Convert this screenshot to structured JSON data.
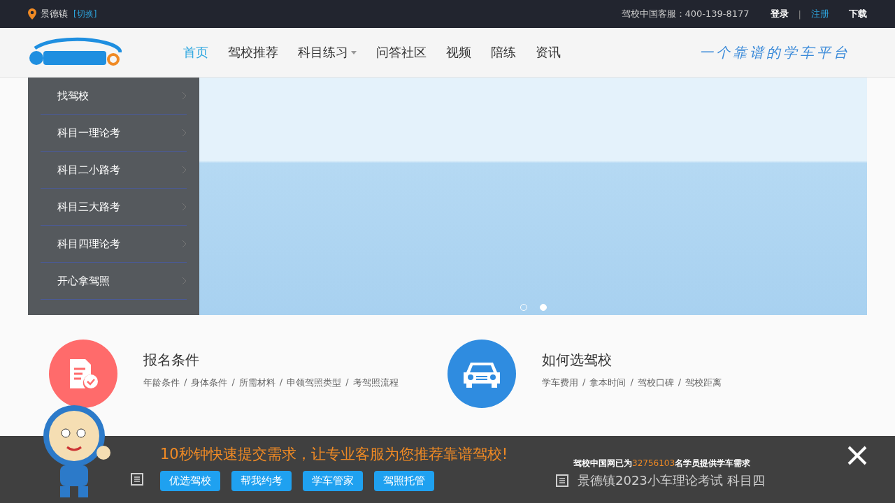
{
  "topbar": {
    "city": "景德镇",
    "switch": "[切换]",
    "hotline": "驾校中国客服：400-139-8177",
    "divider": "|",
    "links": [
      {
        "label": "登录",
        "kind": "plain"
      },
      {
        "label": "注册",
        "kind": "accent"
      },
      {
        "label": "下载",
        "kind": "plain"
      }
    ]
  },
  "nav": {
    "items": [
      {
        "label": "首页",
        "selected": true,
        "dropdown": false
      },
      {
        "label": "驾校推荐",
        "selected": false,
        "dropdown": false
      },
      {
        "label": "科目练习",
        "selected": false,
        "dropdown": true
      },
      {
        "label": "问答社区",
        "selected": false,
        "dropdown": false
      },
      {
        "label": "视频",
        "selected": false,
        "dropdown": false
      },
      {
        "label": "陪练",
        "selected": false,
        "dropdown": false
      },
      {
        "label": "资讯",
        "selected": false,
        "dropdown": false
      }
    ],
    "slogan": "一个靠谱的学车平台"
  },
  "sidebar": {
    "items": [
      "找驾校",
      "科目一理论考",
      "科目二小路考",
      "科目三大路考",
      "科目四理论考",
      "开心拿驾照"
    ]
  },
  "carousel": {
    "dots": [
      {
        "selected": false
      },
      {
        "selected": true
      }
    ]
  },
  "features": [
    {
      "title": "报名条件",
      "kind": "form",
      "color": "#ff6b6b",
      "links": [
        "年龄条件",
        "身体条件",
        "所需材料",
        "申领驾照类型",
        "考驾照流程"
      ]
    },
    {
      "title": "如何选驾校",
      "kind": "car",
      "color": "#2f8ce0",
      "links": [
        "学车费用",
        "拿本时间",
        "驾校口碑",
        "驾校距离"
      ]
    }
  ],
  "link_separator": "/",
  "news": [
    {
      "title": "景德镇2023小车理论考试 科目四"
    }
  ],
  "promo": {
    "headline": "10秒钟快速提交需求，让专业客服为您推荐靠谱驾校!",
    "stat": "驾校中国网已为**32756103**名学员提供学车需求",
    "buttons": [
      "优选驾校",
      "帮我约考",
      "学车管家",
      "驾照托管"
    ]
  }
}
